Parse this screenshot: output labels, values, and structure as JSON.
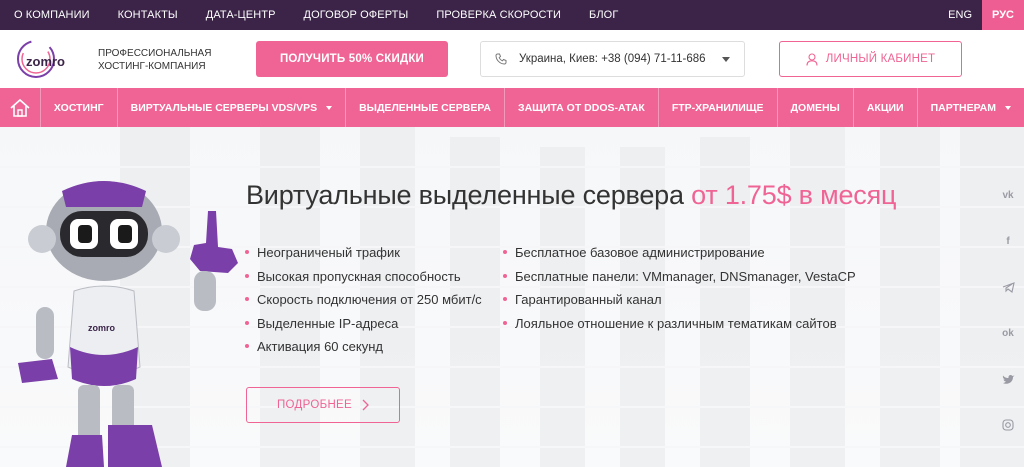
{
  "topbar": {
    "links": [
      "О КОМПАНИИ",
      "КОНТАКТЫ",
      "ДАТА-ЦЕНТР",
      "ДОГОВОР ОФЕРТЫ",
      "ПРОВЕРКА СКОРОСТИ",
      "БЛОГ"
    ],
    "lang_eng": "ENG",
    "lang_rus": "РУС"
  },
  "header": {
    "logo_text": "zomro",
    "tagline_line1": "ПРОФЕССИОНАЛЬНАЯ",
    "tagline_line2": "ХОСТИНГ-КОМПАНИЯ",
    "discount_label": "ПОЛУЧИТЬ 50% СКИДКИ",
    "phone": "Украина, Киев: +38 (094) 71-11-686",
    "cabinet_label": "ЛИЧНЫЙ КАБИНЕТ"
  },
  "nav": {
    "items": [
      "ХОСТИНГ",
      "ВИРТУАЛЬНЫЕ СЕРВЕРЫ VDS/VPS",
      "ВЫДЕЛЕННЫЕ СЕРВЕРА",
      "ЗАЩИТА ОТ DDOS-АТАК",
      "FTP-ХРАНИЛИЩЕ",
      "ДОМЕНЫ",
      "АКЦИИ",
      "ПАРТНЕРАМ"
    ]
  },
  "hero": {
    "title_main": "Виртуальные выделенные сервера ",
    "title_accent": "от 1.75$ в месяц",
    "features_left": [
      "Неограниченый трафик",
      "Высокая пропускная способность",
      "Скорость подключения от 250 мбит/с",
      "Выделенные IP-адреса",
      "Активация 60 секунд"
    ],
    "features_right": [
      "Бесплатное базовое администрирование",
      "Бесплатные панели: VMmanager, DNSmanager, VestaCP",
      "Гарантированный канал",
      "Лояльное отношение к различным тематикам сайтов"
    ],
    "more_label": "ПОДРОБНЕЕ",
    "robot_badge": "zomro"
  },
  "social": {
    "vk": "vk",
    "facebook": "f",
    "ok": "ok"
  },
  "colors": {
    "accent": "#ef6494",
    "topbar": "#3b2448",
    "robot_purple": "#7a3fa8"
  }
}
